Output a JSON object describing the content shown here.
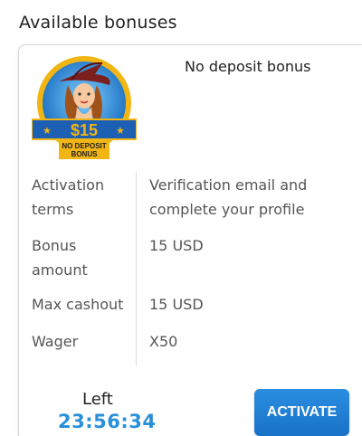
{
  "section": {
    "title": "Available bonuses"
  },
  "bonus": {
    "name": "No deposit bonus",
    "badge": {
      "amount": "$15",
      "line1": "NO DEPOSIT",
      "line2": "BONUS"
    },
    "rows": [
      {
        "label": "Activation terms",
        "value": "Verification email and complete your profile"
      },
      {
        "label": "Bonus amount",
        "value": "15 USD"
      },
      {
        "label": "Max cashout",
        "value": "15 USD"
      },
      {
        "label": "Wager",
        "value": "X50"
      }
    ],
    "timer": {
      "label": "Left",
      "value": "23:56:34"
    },
    "activate_label": "ACTIVATE"
  }
}
